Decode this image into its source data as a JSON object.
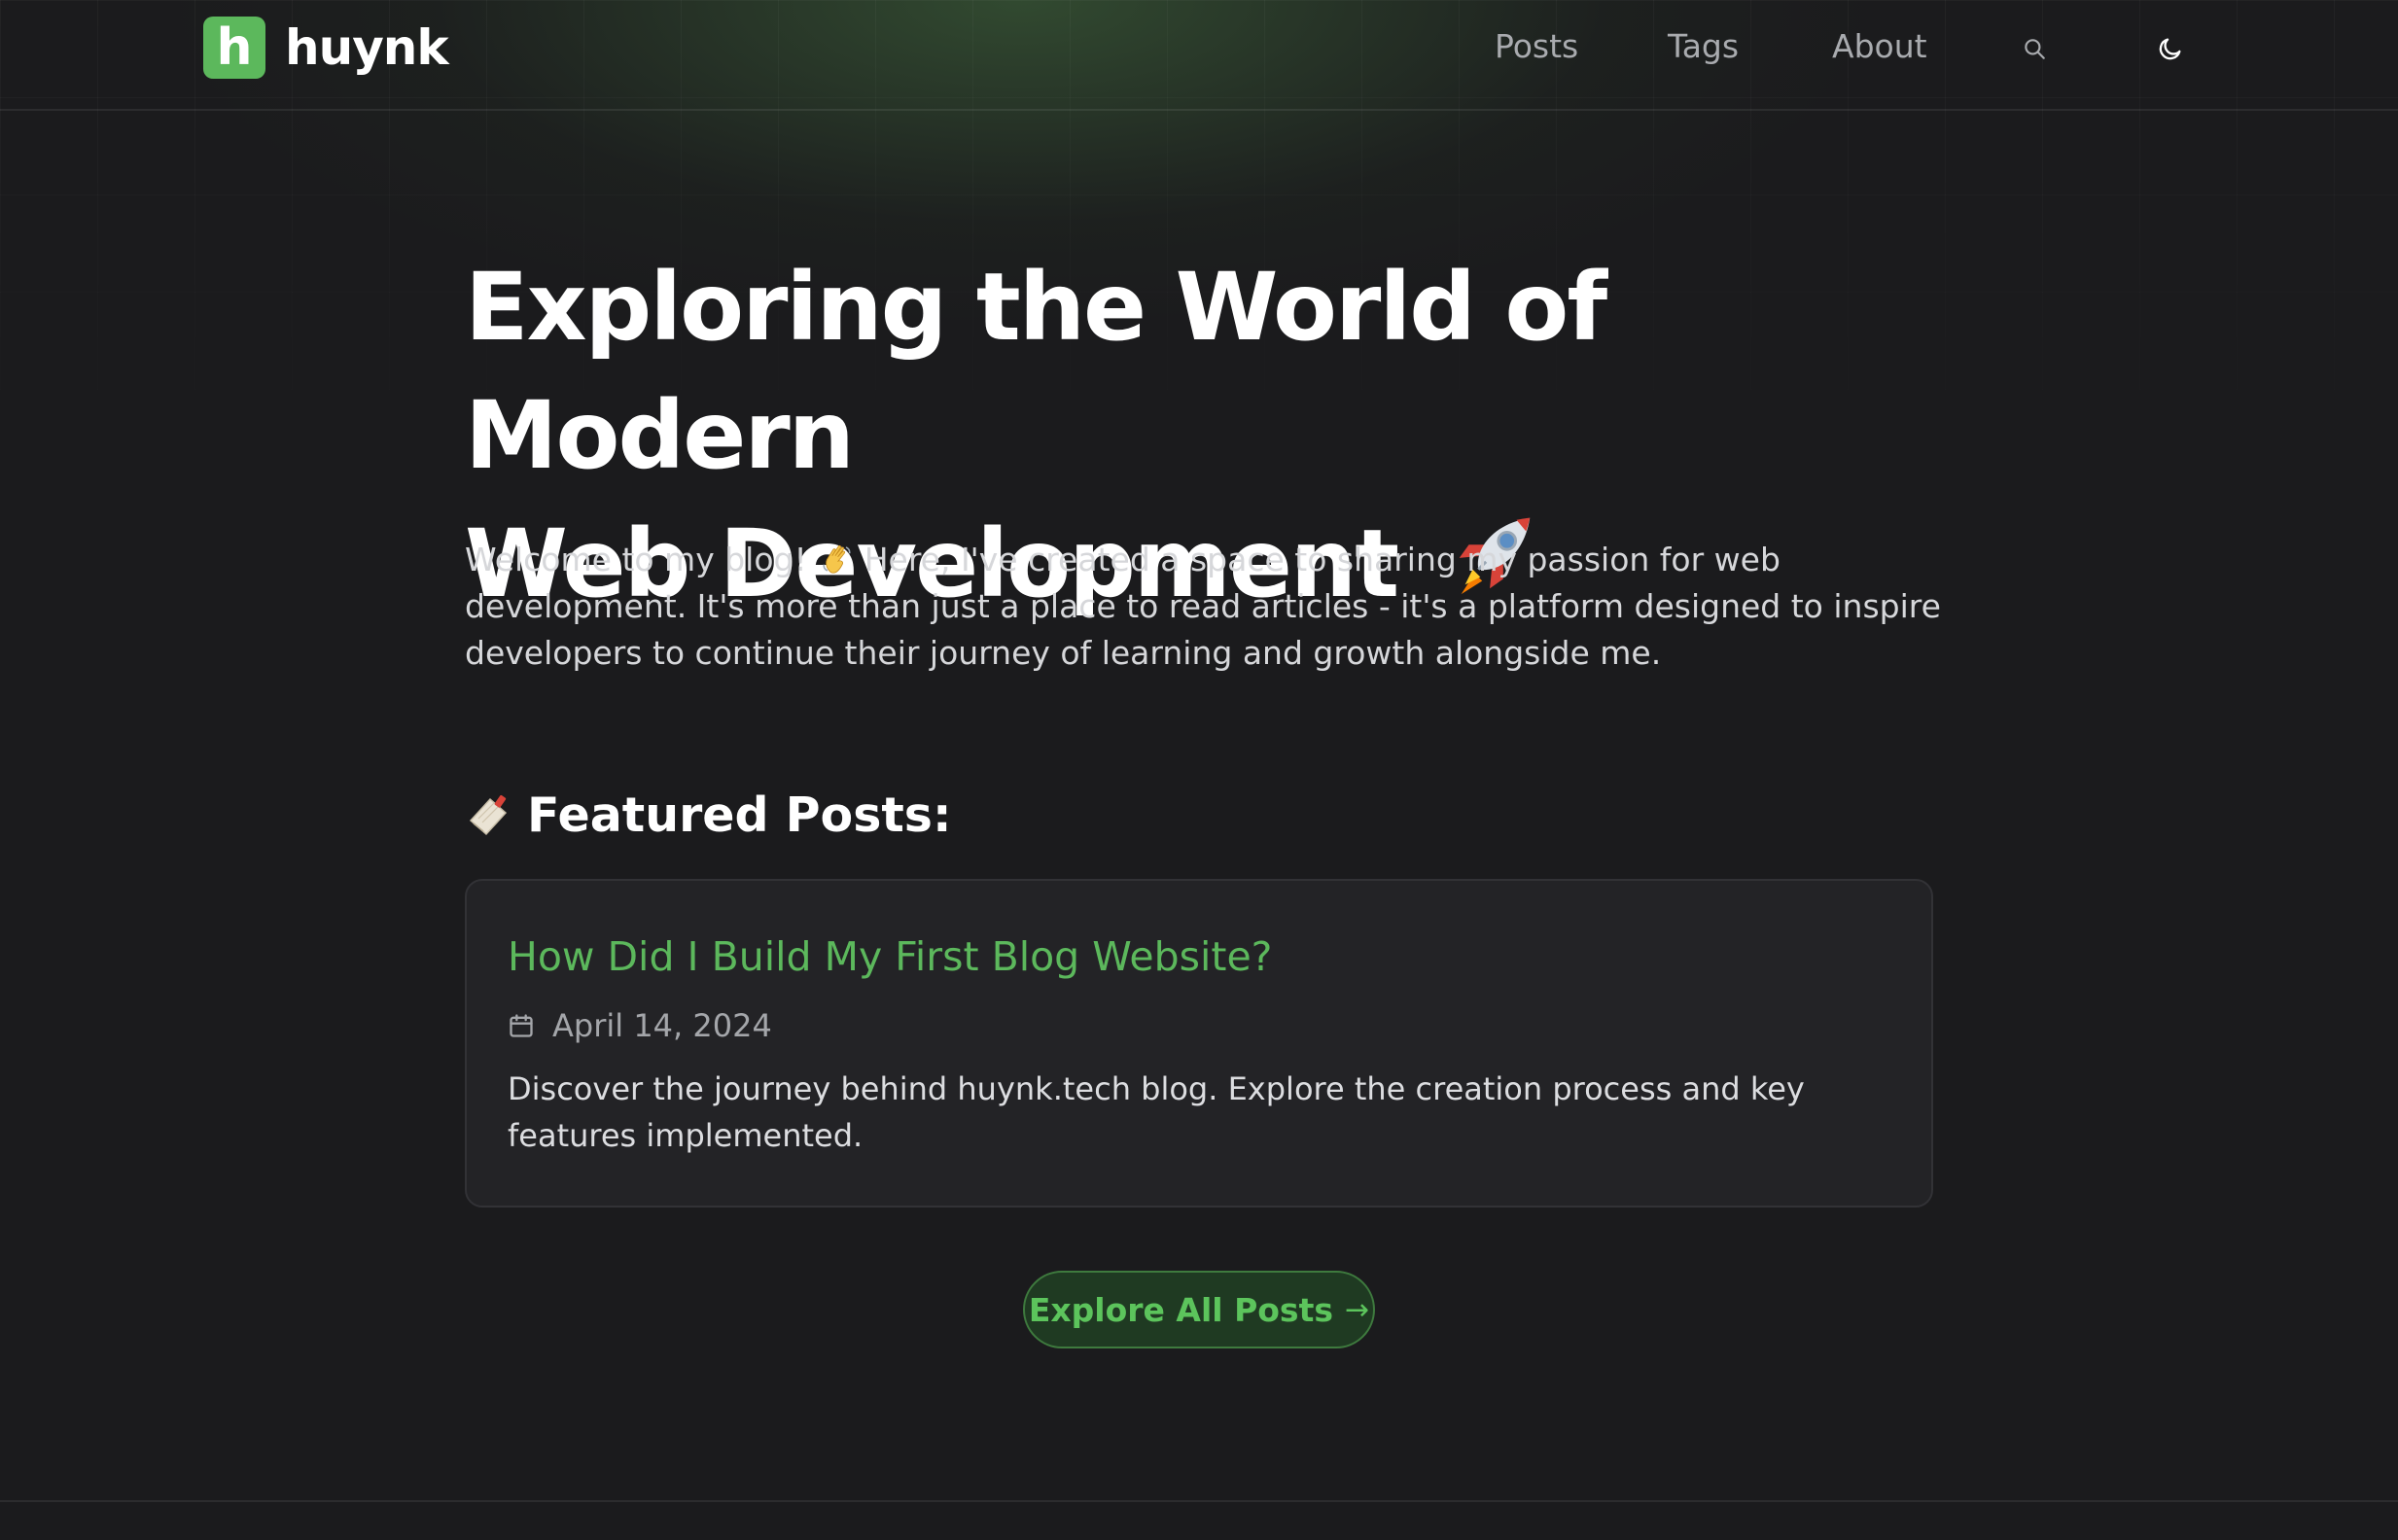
{
  "header": {
    "logo_text": "huynk",
    "logo_glyph": "h",
    "nav": [
      {
        "label": "Posts"
      },
      {
        "label": "Tags"
      },
      {
        "label": "About"
      }
    ],
    "search_icon": "search-icon",
    "theme_icon": "moon-icon"
  },
  "hero": {
    "title_line1": "Exploring the World of Modern",
    "title_line2": "Web Development",
    "title_emoji": "rocket",
    "desc_part1": "Welcome to my blog!",
    "wave_emoji": "waving-hand",
    "desc_part2": " Here, I've created a space to sharing my passion for web development. It's more than just a place to read articles - it's a platform designed to inspire developers to continue their journey of learning and growth alongside me."
  },
  "featured": {
    "heading": "Featured Posts:",
    "heading_icon": "bookmark-tag-icon",
    "posts": [
      {
        "title": "How Did I Build My First Blog Website?",
        "date": "April 14, 2024",
        "description": "Discover the journey behind huynk.tech blog. Explore the creation process and key features implemented."
      }
    ]
  },
  "explore_button": {
    "label": "Explore All Posts",
    "arrow": "→"
  },
  "colors": {
    "accent": "#5cb85c",
    "background": "#1b1b1d",
    "card": "#232326",
    "button_bg": "#1f3a22"
  }
}
